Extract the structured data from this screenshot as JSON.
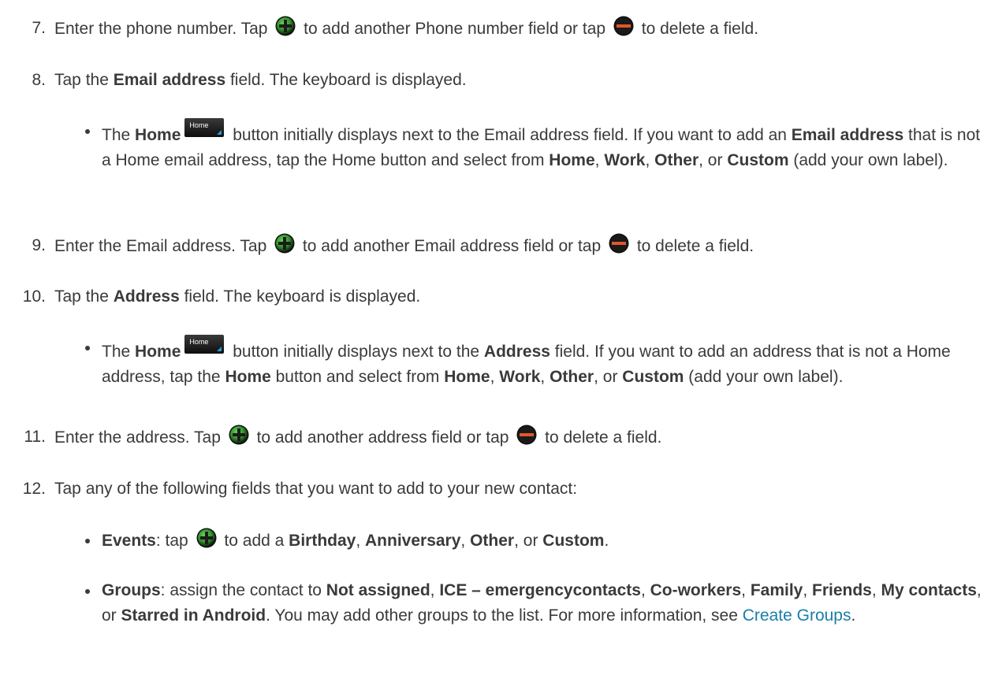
{
  "steps": [
    {
      "num": "7.",
      "t1": "Enter the phone number. Tap ",
      "t2": " to add another Phone number field or tap ",
      "t3": " to delete a field."
    },
    {
      "num": "8.",
      "t1": "Tap the ",
      "b1": "Email address",
      "t2": " field. The keyboard is displayed."
    },
    {
      "num": "9.",
      "t1": "Enter the Email address. Tap ",
      "t2": " to add another Email address field or tap ",
      "t3": " to delete a field."
    },
    {
      "num": "10.",
      "t1": "Tap the ",
      "b1": "Address",
      "t2": " field. The keyboard is displayed."
    },
    {
      "num": "11.",
      "t1": "Enter the address. Tap ",
      "t2": " to add another address field or tap ",
      "t3": " to delete a field."
    },
    {
      "num": "12.",
      "t1": "Tap any of the following fields that you want to add to your new contact:"
    }
  ],
  "bullet_email": {
    "t1": "The ",
    "b1": "Home",
    "btn": "Home",
    "t2": " button initially displays next to the Email address field. If you want to add an ",
    "b2": "Email address",
    "t3": " that is not a Home email address, tap the Home button and select from ",
    "b3": "Home",
    "t4": ", ",
    "b4": "Work",
    "t5": ", ",
    "b5": "Other",
    "t6": ", or ",
    "b6": "Custom",
    "t7": " (add your own label)."
  },
  "bullet_address": {
    "t1": "The ",
    "b1": "Home",
    "btn": "Home",
    "t2": " button initially displays next to the ",
    "b2": "Address",
    "t3": " field. If you want to add an address that is not a Home address, tap the ",
    "b3": "Home",
    "t4": " button and select from ",
    "b4": "Home",
    "t5": ", ",
    "b5": "Work",
    "t6": ", ",
    "b6": "Other",
    "t7": ", or ",
    "b7": "Custom",
    "t8": " (add your own label)."
  },
  "bullet_events": {
    "b1": "Events",
    "t1": ": tap ",
    "t2": " to add a ",
    "b2": "Birthday",
    "t3": ", ",
    "b3": "Anniversary",
    "t4": ", ",
    "b4": "Other",
    "t5": ", or ",
    "b5": "Custom",
    "t6": "."
  },
  "bullet_groups": {
    "b1": "Groups",
    "t1": ": assign the contact to ",
    "b2": "Not assigned",
    "t2": ", ",
    "b3": "ICE – emergencycontacts",
    "t3": ", ",
    "b4": "Co-workers",
    "t4": ", ",
    "b5": "Family",
    "t5": ", ",
    "b6": "Friends",
    "t6": ", ",
    "b7": "My contacts",
    "t7": ", or ",
    "b8": "Starred in Android",
    "t8": ". You may add other groups to the list. For more information, see ",
    "link": "Create Groups",
    "t9": "."
  },
  "icons": {
    "add": "plus-circle-green",
    "delete": "minus-circle-orange-black"
  }
}
